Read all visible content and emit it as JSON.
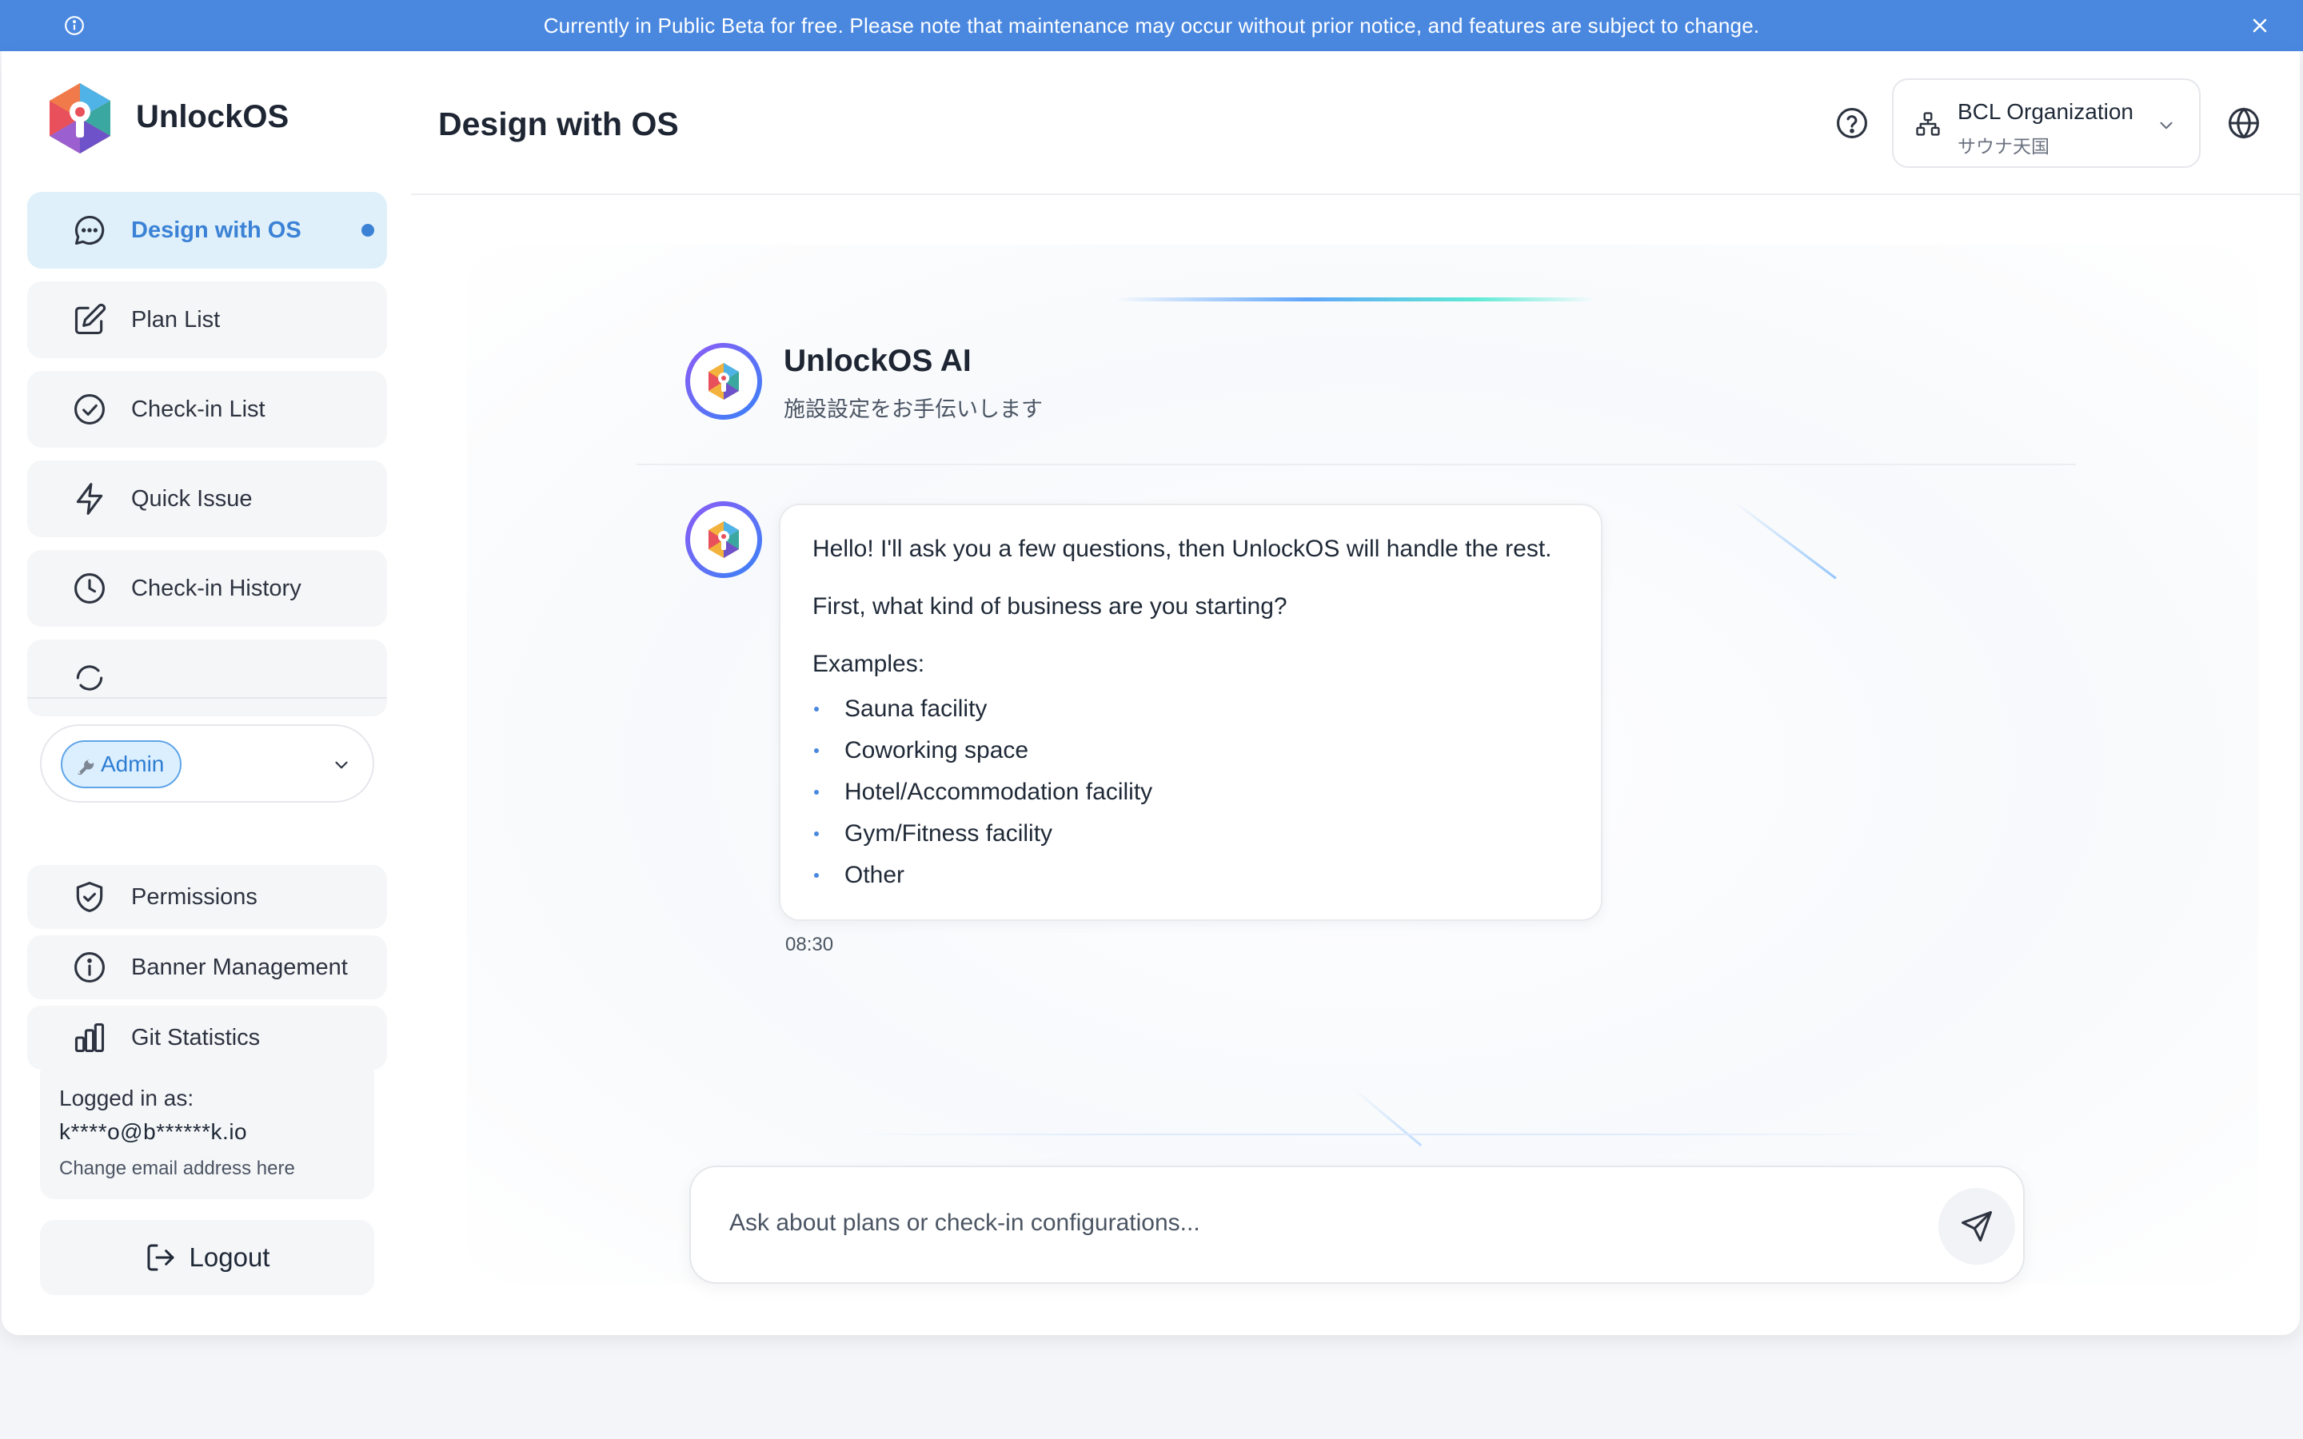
{
  "banner": {
    "text": "Currently in Public Beta for free. Please note that maintenance may occur without prior notice, and features are subject to change.",
    "color": "#4a88e0"
  },
  "brand": {
    "name": "UnlockOS"
  },
  "sidebar": {
    "items": [
      {
        "label": "Design with OS",
        "icon": "chat-bubble-icon",
        "active": true
      },
      {
        "label": "Plan List",
        "icon": "edit-icon"
      },
      {
        "label": "Check-in List",
        "icon": "check-circle-icon"
      },
      {
        "label": "Quick Issue",
        "icon": "lightning-icon"
      },
      {
        "label": "Check-in History",
        "icon": "clock-icon"
      },
      {
        "label": "",
        "icon": "partial-item-icon"
      }
    ],
    "role": {
      "label": "Admin",
      "icon": "wrench-icon"
    },
    "admin_items": [
      {
        "label": "Permissions",
        "icon": "shield-check-icon"
      },
      {
        "label": "Banner Management",
        "icon": "info-circle-icon"
      },
      {
        "label": "Git Statistics",
        "icon": "bar-chart-icon"
      }
    ],
    "login": {
      "label": "Logged in as:",
      "email": "k****o@b******k.io",
      "change_link": "Change email address here"
    },
    "logout_label": "Logout"
  },
  "header": {
    "title": "Design with OS",
    "org": {
      "name": "BCL Organization",
      "sub": "サウナ天国"
    }
  },
  "chat": {
    "assistant_name": "UnlockOS AI",
    "assistant_subtitle": "施設設定をお手伝いします",
    "message": {
      "line1": "Hello! I'll ask you a few questions, then UnlockOS will handle the rest.",
      "line2": "First, what kind of business are you starting?",
      "examples_label": "Examples:",
      "examples": [
        "Sauna facility",
        "Coworking space",
        "Hotel/Accommodation facility",
        "Gym/Fitness facility",
        "Other"
      ],
      "time": "08:30"
    },
    "input_placeholder": "Ask about plans or check-in configurations...",
    "input_value": ""
  },
  "colors": {
    "accent": "#3b82d6",
    "active_bg": "#dff0fa",
    "item_bg": "#f5f6f8"
  }
}
